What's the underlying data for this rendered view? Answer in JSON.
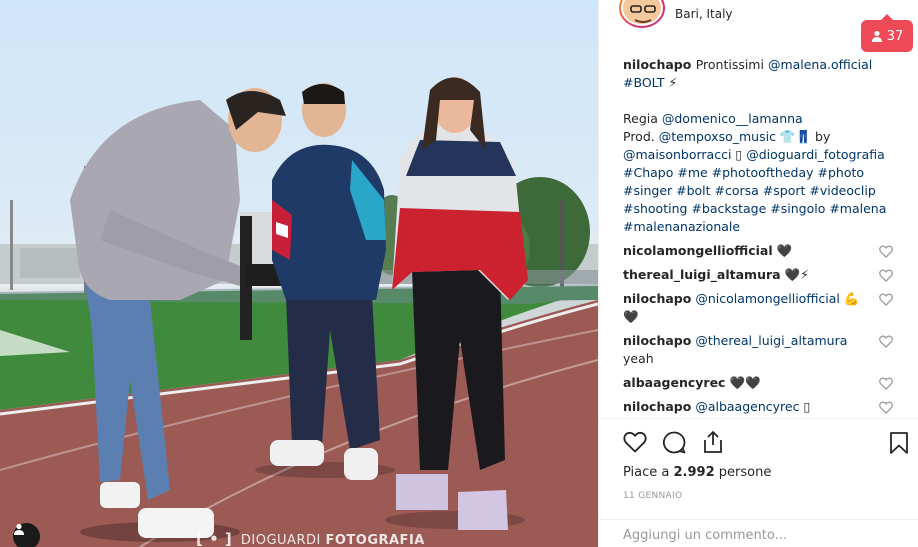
{
  "post": {
    "location": "Bari, Italy",
    "notifications_count": "37",
    "caption": {
      "user": "nilochapo",
      "lines": [
        {
          "parts": [
            {
              "t": "text",
              "v": "Prontissimi "
            },
            {
              "t": "link",
              "v": "@malena.official"
            }
          ]
        },
        {
          "parts": [
            {
              "t": "link",
              "v": "#BOLT"
            },
            {
              "t": "text",
              "v": " ⚡"
            }
          ]
        },
        {
          "parts": [
            {
              "t": "text",
              "v": " "
            }
          ]
        },
        {
          "parts": [
            {
              "t": "text",
              "v": "Regia "
            },
            {
              "t": "link",
              "v": "@domenico__lamanna"
            }
          ]
        },
        {
          "parts": [
            {
              "t": "text",
              "v": "Prod. "
            },
            {
              "t": "link",
              "v": "@tempoxso_music"
            },
            {
              "t": "text",
              "v": " 👕👖 by"
            }
          ]
        },
        {
          "parts": [
            {
              "t": "link",
              "v": "@maisonborracci"
            },
            {
              "t": "text",
              "v": " ▯ "
            },
            {
              "t": "link",
              "v": "@dioguardi_fotografia"
            }
          ]
        },
        {
          "parts": [
            {
              "t": "link",
              "v": "#Chapo #me #photooftheday #photo"
            }
          ]
        },
        {
          "parts": [
            {
              "t": "link",
              "v": "#singer #bolt #corsa #sport #videoclip"
            }
          ]
        },
        {
          "parts": [
            {
              "t": "link",
              "v": "#shooting #backstage #singolo #malena"
            }
          ]
        },
        {
          "parts": [
            {
              "t": "link",
              "v": "#malenanazionale"
            }
          ]
        }
      ]
    },
    "comments": [
      {
        "user": "nicolamongelliofficial",
        "text": " 🖤"
      },
      {
        "user": "thereal_luigi_altamura",
        "text": " 🖤⚡"
      },
      {
        "user": "nilochapo",
        "mention": "@nicolamongelliofficial",
        "text": " 💪🖤"
      },
      {
        "user": "nilochapo",
        "mention": "@thereal_luigi_altamura",
        "text": " yeah"
      },
      {
        "user": "albaagencyrec",
        "text": " 🖤🖤"
      },
      {
        "user": "nilochapo",
        "mention": "@albaagencyrec",
        "text": " ▯"
      }
    ],
    "likes_prefix": "Piace a ",
    "likes_count": "2.992",
    "likes_suffix": " persone",
    "date": "11 GENNAIO",
    "comment_placeholder": "Aggiungi un commento...",
    "watermark_mark": "[ • ]",
    "watermark_name": "DIOGUARDI",
    "watermark_strong": "FOTOGRAFIA"
  },
  "icons": {
    "like": "heart-icon",
    "comment": "comment-bubble-icon",
    "share": "share-icon",
    "save": "bookmark-icon",
    "tag": "user-icon"
  },
  "colors": {
    "notification": "#ed4956",
    "link": "#003569",
    "track": "#9c5a55"
  }
}
